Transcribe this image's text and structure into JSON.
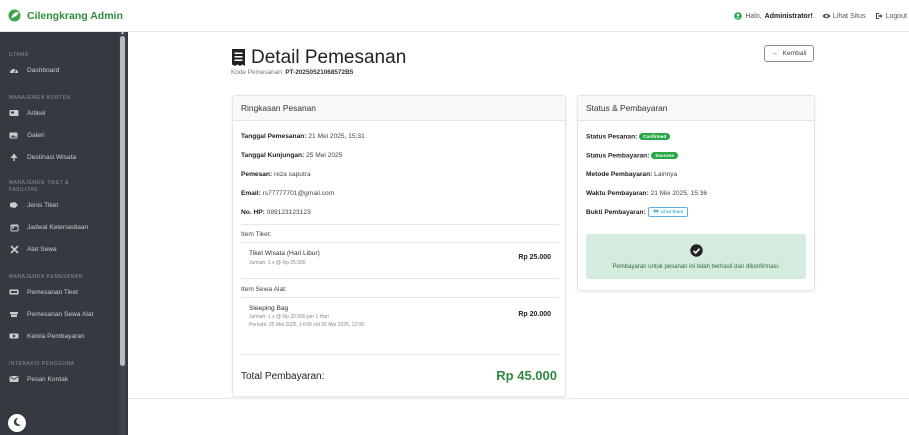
{
  "brand": {
    "name": "Cilengkrang Admin"
  },
  "topnav": {
    "greeting_prefix": "Halo,",
    "user": "Administrator!",
    "view_site": "Lihat Situs",
    "logout": "Logout"
  },
  "sidebar": {
    "sections": [
      {
        "title": "UTAMA",
        "items": [
          {
            "label": "Dashboard",
            "icon": "tachometer-icon"
          }
        ]
      },
      {
        "title": "MANAJEMEN KONTEN",
        "items": [
          {
            "label": "Artikel",
            "icon": "newspaper-icon"
          },
          {
            "label": "Galeri",
            "icon": "images-icon"
          },
          {
            "label": "Destinasi Wisata",
            "icon": "tree-icon"
          }
        ]
      },
      {
        "title": "MANAJEMEN TIKET & FASILITAS",
        "items": [
          {
            "label": "Jenis Tiket",
            "icon": "ticket-icon"
          },
          {
            "label": "Jadwal Ketersediaan",
            "icon": "calendar-icon"
          },
          {
            "label": "Alat Sewa",
            "icon": "tools-icon"
          }
        ]
      },
      {
        "title": "MANAJEMEN PEMESANAN",
        "items": [
          {
            "label": "Pemesanan Tiket",
            "icon": "receipt-icon"
          },
          {
            "label": "Pemesanan Sewa Alat",
            "icon": "box-icon"
          },
          {
            "label": "Kelola Pembayaran",
            "icon": "money-icon"
          }
        ]
      },
      {
        "title": "INTERAKSI PENGGUNA",
        "items": [
          {
            "label": "Pesan Kontak",
            "icon": "envelope-icon"
          }
        ]
      }
    ]
  },
  "page": {
    "title": "Detail Pemesanan",
    "code_label": "Kode Pemesanan:",
    "code_value": "PT-20250521068572B5",
    "back_button": "Kembali"
  },
  "summary": {
    "header": "Ringkasan Pesanan",
    "order_date_label": "Tanggal Pemesanan:",
    "order_date_value": "21 Mei 2025, 15:31",
    "visit_date_label": "Tanggal Kunjungan:",
    "visit_date_value": "25 Mei 2025",
    "customer_label": "Pemesan:",
    "customer_value": "reza saputra",
    "email_label": "Email:",
    "email_value": "rs77777701@gmail.com",
    "phone_label": "No. HP:",
    "phone_value": "089123123123",
    "tickets_label": "Item Tiket:",
    "ticket_item": {
      "name": "Tiket Wisata (Hari Libur)",
      "detail": "Jumlah: 1 x @ Rp 25.000",
      "price": "Rp 25.000"
    },
    "rentals_label": "Item Sewa Alat:",
    "rental_item": {
      "name": "Sleeping Bag",
      "detail": "Jumlah: 1 x @ Rp 20.000 per 1 Hari",
      "period": "Periode: 25 Mei 2025, 14:00 s/d 26 Mei 2025, 12:00",
      "price": "Rp 20.000"
    },
    "total_label": "Total Pembayaran:",
    "total_value": "Rp 45.000"
  },
  "status": {
    "header": "Status & Pembayaran",
    "order_status_label": "Status Pesanan:",
    "order_status_badge": "Confirmed",
    "payment_status_label": "Status Pembayaran:",
    "payment_status_badge": "Success",
    "method_label": "Metode Pembayaran:",
    "method_value": "Lainnya",
    "payment_time_label": "Waktu Pembayaran:",
    "payment_time_value": "21 Mei 2025, 15:36",
    "proof_label": "Bukti Pembayaran:",
    "proof_button": "Lihat Bukti",
    "alert_text": "Pembayaran untuk pesanan ini telah berhasil dan dikonfirmasi."
  },
  "colors": {
    "brand": "#2e8b3e",
    "sidebar": "#343a40",
    "success": "#28a745"
  }
}
